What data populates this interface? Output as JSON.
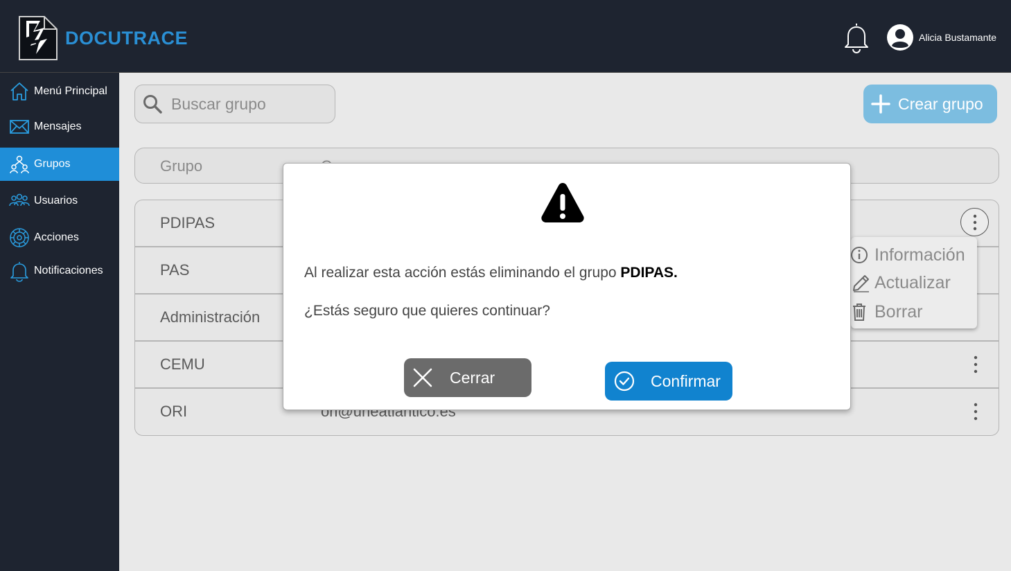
{
  "app": {
    "title": "DOCUTRACE"
  },
  "header": {
    "username": "Alicia Bustamante"
  },
  "sidebar": {
    "items": [
      {
        "label": "Menú Principal",
        "icon": "home-icon"
      },
      {
        "label": "Mensajes",
        "icon": "mail-icon"
      },
      {
        "label": "Grupos",
        "icon": "groups-icon",
        "active": true
      },
      {
        "label": "Usuarios",
        "icon": "users-icon"
      },
      {
        "label": "Acciones",
        "icon": "actions-icon"
      },
      {
        "label": "Notificaciones",
        "icon": "bell-icon"
      }
    ]
  },
  "search": {
    "placeholder": "Buscar grupo"
  },
  "toolbar": {
    "create_label": "Crear grupo"
  },
  "table": {
    "columns": [
      "Grupo",
      "C"
    ],
    "rows": [
      {
        "name": "PDIPAS",
        "email": ""
      },
      {
        "name": "PAS",
        "email": ""
      },
      {
        "name": "Administración",
        "email": ""
      },
      {
        "name": "CEMU",
        "email": ""
      },
      {
        "name": "ORI",
        "email": "ori@uneatlantico.es"
      }
    ]
  },
  "context_menu": {
    "items": [
      {
        "label": "Información",
        "icon": "info-icon"
      },
      {
        "label": "Actualizar",
        "icon": "edit-icon"
      },
      {
        "label": "Borrar",
        "icon": "trash-icon"
      }
    ]
  },
  "modal": {
    "message_prefix": "Al realizar esta acción estás eliminando el grupo ",
    "group_name": "PDIPAS.",
    "question": "¿Estás seguro que quieres continuar?",
    "close_label": "Cerrar",
    "confirm_label": "Confirmar"
  },
  "colors": {
    "header_bg": "#1e2430",
    "accent": "#1f8ed8",
    "create_button": "#7cbde0",
    "confirm_button": "#1183cf",
    "close_button": "#6b6b6b"
  }
}
